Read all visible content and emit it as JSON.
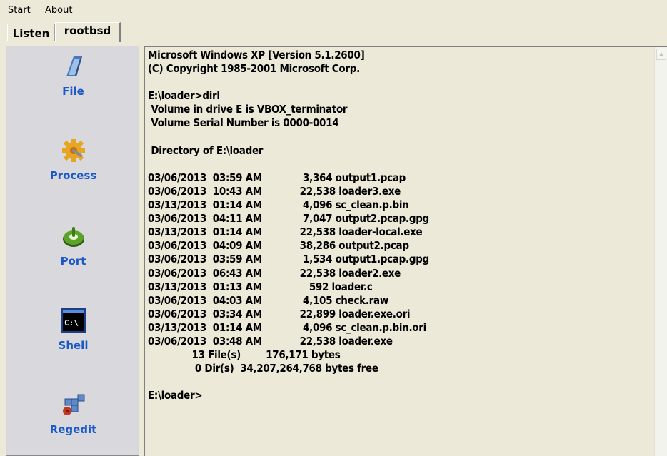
{
  "menu": {
    "items": [
      "Start",
      "About"
    ]
  },
  "tabs": [
    {
      "label": "Listen",
      "active": false
    },
    {
      "label": "rootbsd",
      "active": true
    }
  ],
  "sidebar": {
    "items": [
      {
        "label": "File",
        "icon": "file-icon"
      },
      {
        "label": "Process",
        "icon": "process-gear-icon"
      },
      {
        "label": "Port",
        "icon": "port-icon"
      },
      {
        "label": "Shell",
        "icon": "shell-console-icon"
      },
      {
        "label": "Regedit",
        "icon": "regedit-icon"
      }
    ],
    "label_color": "#1a58c8"
  },
  "console": {
    "lines": [
      "Microsoft Windows XP [Version 5.1.2600]",
      "(C) Copyright 1985-2001 Microsoft Corp.",
      "",
      "E:\\loader>dirl",
      " Volume in drive E is VBOX_terminator",
      " Volume Serial Number is 0000-0014",
      "",
      " Directory of E:\\loader",
      "",
      "03/06/2013  03:59 AM             3,364 output1.pcap",
      "03/06/2013  10:43 AM            22,538 loader3.exe",
      "03/13/2013  01:14 AM             4,096 sc_clean.p.bin",
      "03/06/2013  04:11 AM             7,047 output2.pcap.gpg",
      "03/13/2013  01:14 AM            22,538 loader-local.exe",
      "03/06/2013  04:09 AM            38,286 output2.pcap",
      "03/06/2013  03:59 AM             1,534 output1.pcap.gpg",
      "03/06/2013  06:43 AM            22,538 loader2.exe",
      "03/13/2013  01:13 AM               592 loader.c",
      "03/06/2013  04:03 AM             4,105 check.raw",
      "03/06/2013  03:34 AM            22,899 loader.exe.ori",
      "03/13/2013  01:14 AM             4,096 sc_clean.p.bin.ori",
      "03/06/2013  03:48 AM            22,538 loader.exe",
      "              13 File(s)        176,171 bytes",
      "               0 Dir(s)  34,207,264,768 bytes free",
      "",
      "E:\\loader>"
    ]
  }
}
